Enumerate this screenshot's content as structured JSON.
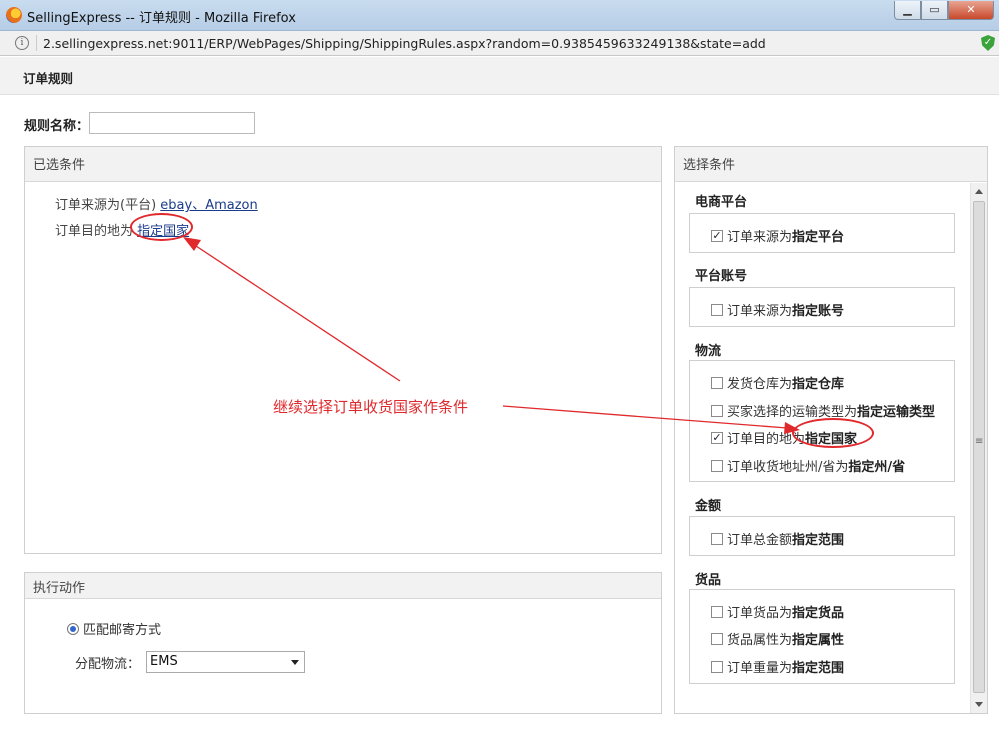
{
  "window": {
    "title": "SellingExpress -- 订单规则 - Mozilla Firefox",
    "url": "2.sellingexpress.net:9011/ERP/WebPages/Shipping/ShippingRules.aspx?random=0.9385459633249138&state=add",
    "icon": "firefox-icon"
  },
  "dialog": {
    "title": "订单规则"
  },
  "rule_name": {
    "label": "规则名称：",
    "value": ""
  },
  "selected": {
    "title": "已选条件",
    "lines": [
      {
        "prefix": "订单来源为(平台) ",
        "link": "ebay、Amazon"
      },
      {
        "prefix": "订单目的地为 ",
        "link": "指定国家"
      }
    ]
  },
  "annotation": {
    "text": "继续选择订单收货国家作条件",
    "color": "#e0292c"
  },
  "action": {
    "title": "执行动作",
    "radio_label": "匹配邮寄方式",
    "alloc_label": "分配物流：",
    "alloc_value": "EMS"
  },
  "conditions": {
    "title": "选择条件",
    "groups": [
      {
        "title": "电商平台",
        "items": [
          {
            "pre": "订单来源为",
            "bold": "指定平台",
            "checked": true
          }
        ]
      },
      {
        "title": "平台账号",
        "items": [
          {
            "pre": "订单来源为",
            "bold": "指定账号",
            "checked": false
          }
        ]
      },
      {
        "title": "物流",
        "items": [
          {
            "pre": "发货仓库为",
            "bold": "指定仓库",
            "checked": false
          },
          {
            "pre": "买家选择的运输类型为",
            "bold": "指定运输类型",
            "checked": false
          },
          {
            "pre": "订单目的地为",
            "bold": "指定国家",
            "checked": true
          },
          {
            "pre": "订单收货地址州/省为",
            "bold": "指定州/省",
            "checked": false
          }
        ]
      },
      {
        "title": "金额",
        "items": [
          {
            "pre": "订单总金额",
            "bold": "指定范围",
            "checked": false
          }
        ]
      },
      {
        "title": "货品",
        "items": [
          {
            "pre": "订单货品为",
            "bold": "指定货品",
            "checked": false
          },
          {
            "pre": "货品属性为",
            "bold": "指定属性",
            "checked": false
          },
          {
            "pre": "订单重量为",
            "bold": "指定范围",
            "checked": false
          }
        ]
      }
    ]
  }
}
